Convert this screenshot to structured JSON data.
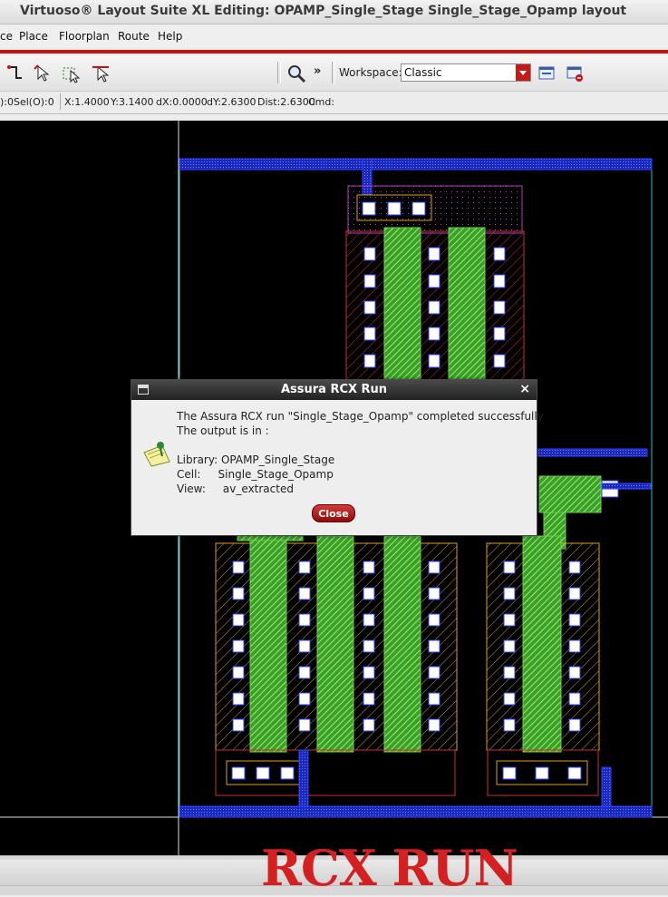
{
  "window": {
    "title": "Virtuoso® Layout Suite XL Editing: OPAMP_Single_Stage Single_Stage_Opamp layout"
  },
  "menu": {
    "items": [
      "ce",
      "Place",
      "Floorplan",
      "Route",
      "Help"
    ]
  },
  "toolbar": {
    "more_label": "»",
    "workspace_label": "Workspace:",
    "workspace_value": "Classic"
  },
  "status": {
    "sel": "):0Sel(O):0",
    "x": "X:1.4000",
    "y": "Y:3.1400",
    "dx": "dX:0.0000",
    "dy": "dY:2.6300",
    "dist": "Dist:2.6300",
    "cmd": "Cmd:"
  },
  "dialog": {
    "title": "Assura RCX Run",
    "close_x": "×",
    "message": "The Assura RCX run \"Single_Stage_Opamp\" completed successfully",
    "output_line": "The output is in :",
    "library": "Library: OPAMP_Single_Stage",
    "cell": "Cell:     Single_Stage_Opamp",
    "view": "View:     av_extracted",
    "close_button": "Close"
  },
  "overlay_text": "RCX RUN",
  "colors": {
    "accent_red": "#c81414",
    "canvas_bg": "#000000",
    "poly_green": "#66d044",
    "metal_blue": "#2030d0",
    "active_orange": "#e0a020",
    "contact_white": "#ffffff"
  }
}
